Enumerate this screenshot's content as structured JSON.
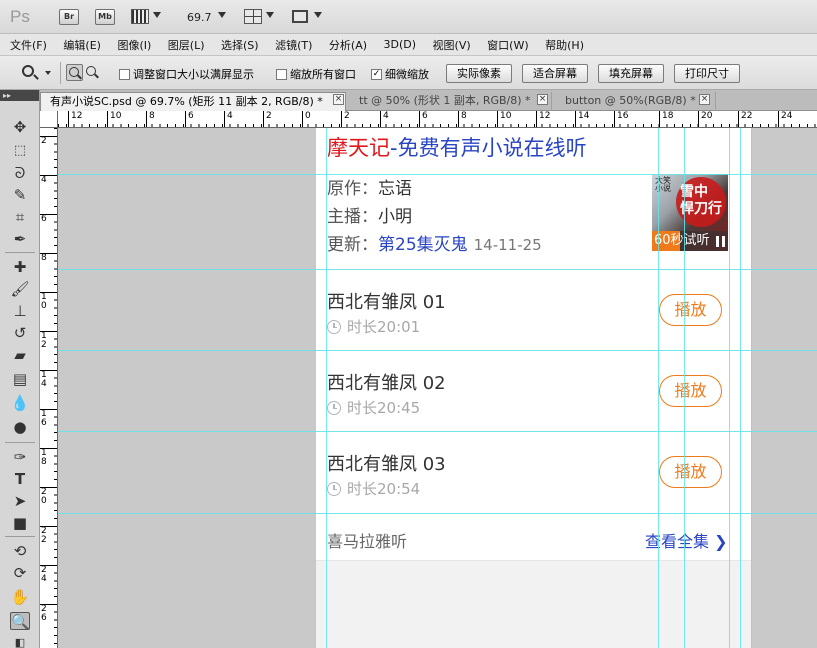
{
  "appbar": {
    "logo": "Ps",
    "bridge_label": "Br",
    "minibridge_label": "Mb",
    "zoom": "69.7",
    "icons": [
      "bridge-icon",
      "mini-bridge-icon",
      "view-extras-icon",
      "arrange-documents-icon",
      "screen-mode-icon"
    ]
  },
  "menu": [
    "文件(F)",
    "编辑(E)",
    "图像(I)",
    "图层(L)",
    "选择(S)",
    "滤镜(T)",
    "分析(A)",
    "3D(D)",
    "视图(V)",
    "窗口(W)",
    "帮助(H)"
  ],
  "options": {
    "resize_windows": "调整窗口大小以满屏显示",
    "zoom_all": "缩放所有窗口",
    "scrubby_zoom": "细微缩放",
    "scrubby_checked": true,
    "actual_pixels": "实际像素",
    "fit_screen": "适合屏幕",
    "fill_screen": "填充屏幕",
    "print_size": "打印尺寸"
  },
  "tabs": [
    {
      "label": "有声小说SC.psd @ 69.7% (矩形 11 副本 2, RGB/8) *",
      "active": true
    },
    {
      "label": "tt @ 50% (形状 1 副本, RGB/8) *",
      "active": false
    },
    {
      "label": "button @ 50%(RGB/8) *",
      "active": false
    }
  ],
  "ruler": {
    "top": [
      "12",
      "10",
      "8",
      "6",
      "4",
      "2",
      "0",
      "2",
      "4",
      "6",
      "8",
      "10",
      "12",
      "14",
      "16",
      "18",
      "20",
      "22",
      "24"
    ],
    "left": [
      "2",
      "4",
      "6",
      "8",
      "1\n0",
      "1\n2",
      "1\n4",
      "1\n6",
      "1\n8",
      "2\n0",
      "2\n2",
      "2\n4",
      "2\n6"
    ]
  },
  "content": {
    "title_red": "摩天记",
    "title_blue": "-免费有声小说在线听",
    "author_label": "原作：",
    "author": "忘语",
    "narrator_label": "主播：",
    "narrator": "小明",
    "update_label": "更新：",
    "update_episode": "第25集灭鬼",
    "update_date": "14-11-25",
    "cover": {
      "small_text": "大笑\n小说",
      "brush_text": "雪中\n悍刀行",
      "trial": "60秒试听"
    },
    "episodes": [
      {
        "title": "西北有雏凤  01",
        "duration": "时长20:01",
        "play": "播放"
      },
      {
        "title": "西北有雏凤  02",
        "duration": "时长20:45",
        "play": "播放"
      },
      {
        "title": "西北有雏凤  03",
        "duration": "时长20:54",
        "play": "播放"
      }
    ],
    "footer_left": "喜马拉雅听",
    "footer_right": "查看全集 ❯"
  },
  "colors": {
    "title_red": "#e0161b",
    "link_blue": "#2a45c4",
    "accent_orange": "#f07a1a",
    "guide_cyan": "#5fe6ec"
  }
}
